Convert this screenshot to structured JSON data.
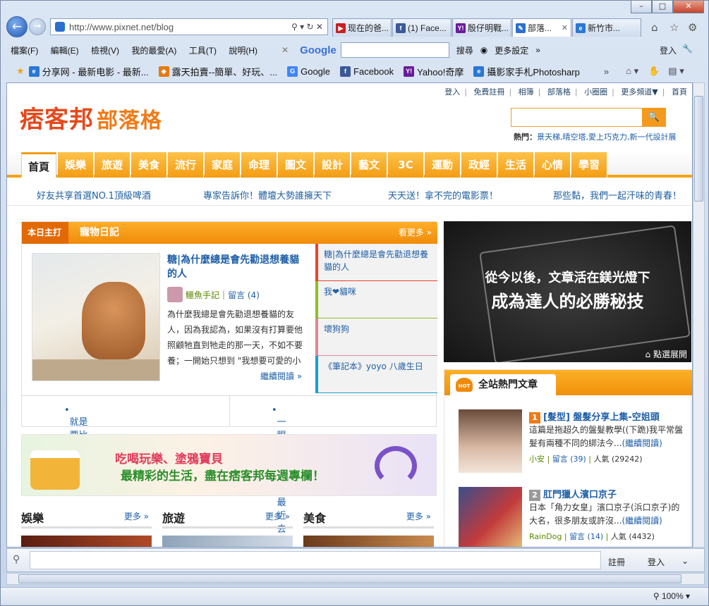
{
  "browser": {
    "address": "http://www.pixnet.net/blog",
    "address_controls": "⚲ ▾ ↻ ✕",
    "tabs": [
      {
        "label": "现在的爸...",
        "icon_color": "#cc1f1f",
        "icon_text": "▶"
      },
      {
        "label": "(1) Face...",
        "icon_color": "#3b5998",
        "icon_text": "f"
      },
      {
        "label": "殷仔明戰...",
        "icon_color": "#6a1b9a",
        "icon_text": "Y!"
      },
      {
        "label": "部落...",
        "icon_color": "#2b6fd1",
        "icon_text": "✎",
        "active": true
      },
      {
        "label": "新竹市...",
        "icon_color": "#2a77d4",
        "icon_text": "e"
      }
    ],
    "menu": [
      "檔案(F)",
      "編輯(E)",
      "檢視(V)",
      "我的最愛(A)",
      "工具(T)",
      "說明(H)"
    ],
    "google_label": "Google",
    "google_search_label": "搜尋",
    "more_settings": "更多設定",
    "login": "登入",
    "favorites": [
      {
        "label": "分享网 - 最新电影 - 最新...",
        "icon_color": "#2a77d4",
        "icon_text": "e"
      },
      {
        "label": "露天拍賣--簡單、好玩、...",
        "icon_color": "#e47a12",
        "icon_text": "◆"
      },
      {
        "label": "Google",
        "icon_color": "#4285f4",
        "icon_text": "G"
      },
      {
        "label": "Facebook",
        "icon_color": "#3b5998",
        "icon_text": "f"
      },
      {
        "label": "Yahoo!奇摩",
        "icon_color": "#6a1b9a",
        "icon_text": "Y!"
      },
      {
        "label": "攝影家手札Photosharp",
        "icon_color": "#2a77d4",
        "icon_text": "e"
      }
    ],
    "find_buttons": [
      "註冊",
      "登入"
    ],
    "zoom": "100%"
  },
  "site": {
    "top_links": [
      "登入",
      "免費註冊",
      "相簿",
      "部落格",
      "小圈圈",
      "更多頻道▼",
      "首頁"
    ],
    "logo": "痞客邦",
    "logo_sub": "部落格",
    "search_button": "🔍",
    "hot_label": "熱門：",
    "hot_terms": "景天梯,晴空塔,愛上巧克力,新一代設計展",
    "categories": [
      "首頁",
      "娛樂",
      "旅遊",
      "美食",
      "流行",
      "家庭",
      "命理",
      "圖文",
      "設計",
      "藝文",
      "3C",
      "運動",
      "政經",
      "生活",
      "心情",
      "學習"
    ],
    "promos": [
      "好友共享首選NO.1頂級啤酒",
      "專家告訴你！體壇大勢誰擁天下",
      "天天送！拿不完的電影票！",
      "那些黏，我們一起汗味的青春！"
    ],
    "featured": {
      "tag": "本日主打",
      "title": "寵物日記",
      "more": "看更多 »",
      "post_title": "糖|為什麼總是會先勸退想養貓的人",
      "author": "鱷魚手記",
      "comments": "留言 (4)",
      "excerpt": "為什麼我總是會先勸退想養貓的友人，因為我認為，如果沒有打算要他照顧牠直到牠走的那一天，不如不要養；一開始只想到 \"我想要可愛的小",
      "read_more": "繼續閱讀 »",
      "list": [
        {
          "label": "糖|為什麼總是會先勸退想養貓的人",
          "color": "#e8442a"
        },
        {
          "label": "我❤貓咪",
          "color": "#8dbf22"
        },
        {
          "label": "壞狗狗",
          "color": "#d9899a"
        },
        {
          "label": "《筆記本》yoyo 八歲生日",
          "color": "#1b9ec9"
        }
      ],
      "bottom": [
        "就是要比別人快一步分享！",
        "一眼就看出你最近去了哪裡"
      ]
    },
    "banner": {
      "line1": "吃喝玩樂、塗鴉寶貝",
      "line2": "最精彩的生活，盡在痞客邦每週專欄！"
    },
    "sections": [
      {
        "title": "娛樂",
        "more": "更多 »"
      },
      {
        "title": "旅遊",
        "more": "更多 »"
      },
      {
        "title": "美食",
        "more": "更多 »"
      }
    ],
    "dark_banner": {
      "line1": "從今以後，文章活在鎂光燈下",
      "line2": "成為達人的必勝秘技",
      "cta": "點選展開"
    },
    "hot_articles": {
      "title": "全站熱門文章",
      "badge": "HOT",
      "items": [
        {
          "rank": "1",
          "title": "[髮型] 盤髮分享上集-空姐頭",
          "excerpt": "這篇是拖超久的盤髮教學((下跪)我平常盤髮有兩種不同的綁法今...",
          "read": "(繼續閱讀)",
          "author": "小安",
          "comments": "留言 (39)",
          "views": "人氣 (29242)"
        },
        {
          "rank": "2",
          "title": "肛門獵人濱口京子",
          "excerpt": "日本「角力女皇」濱口京子(浜口京子)的大名，很多朋友或許沒...",
          "read": "(繼續閱讀)",
          "author": "RainDog",
          "comments": "留言 (14)",
          "views": "人氣 (4432)"
        }
      ]
    }
  }
}
